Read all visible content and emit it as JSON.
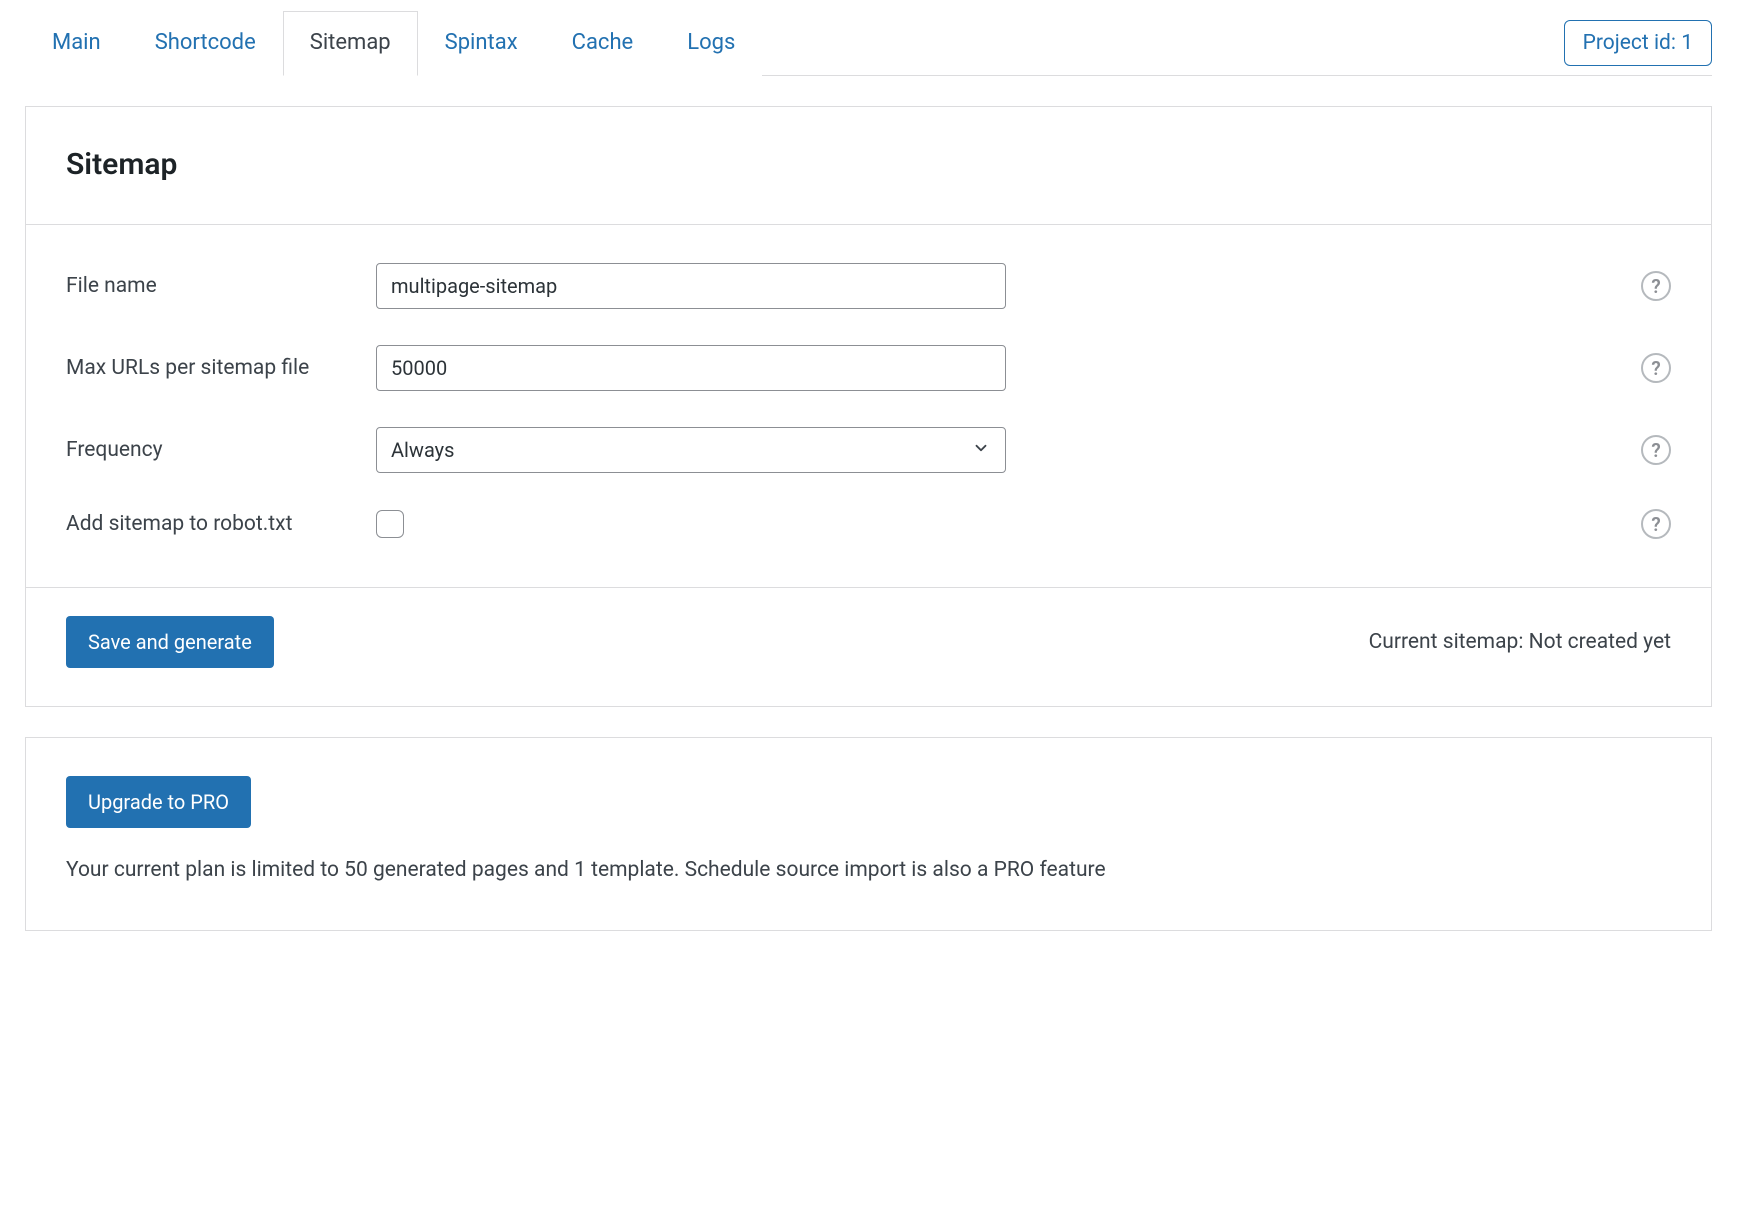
{
  "tabs": {
    "main": "Main",
    "shortcode": "Shortcode",
    "sitemap": "Sitemap",
    "spintax": "Spintax",
    "cache": "Cache",
    "logs": "Logs"
  },
  "project_badge": "Project id: 1",
  "panel": {
    "title": "Sitemap",
    "file_name_label": "File name",
    "file_name_value": "multipage-sitemap",
    "max_urls_label": "Max URLs per sitemap file",
    "max_urls_value": "50000",
    "frequency_label": "Frequency",
    "frequency_value": "Always",
    "robots_label": "Add sitemap to robot.txt",
    "save_button": "Save and generate",
    "status_text": "Current sitemap: Not created yet"
  },
  "upgrade": {
    "button": "Upgrade to PRO",
    "desc": "Your current plan is limited to 50 generated pages and 1 template. Schedule source import is also a PRO feature"
  }
}
